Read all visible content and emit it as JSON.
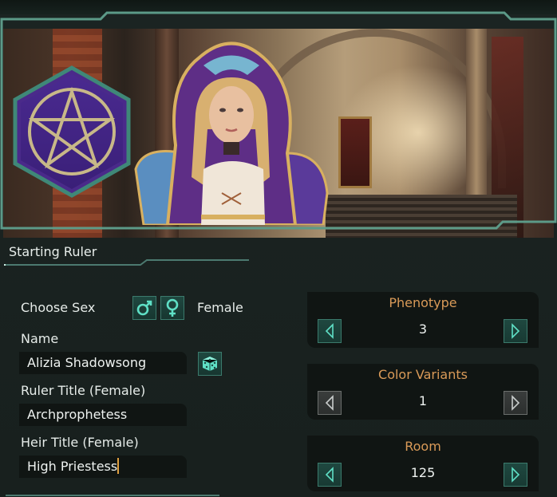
{
  "section": {
    "title": "Starting Ruler"
  },
  "sex": {
    "label": "Choose Sex",
    "male_icon": "male-symbol-icon",
    "female_icon": "female-symbol-icon",
    "selected": "Female"
  },
  "name": {
    "label": "Name",
    "value": "Alizia Shadowsong",
    "randomize_icon": "dice-icon"
  },
  "ruler_title": {
    "label": "Ruler Title (Female)",
    "value": "Archprophetess"
  },
  "heir_title": {
    "label": "Heir Title (Female)",
    "value": "High Priestess"
  },
  "emblem": {
    "icon": "pentagram-icon",
    "color": "#4a2a8a"
  },
  "steppers": [
    {
      "title": "Phenotype",
      "value": "3",
      "left_enabled": true,
      "right_enabled": true
    },
    {
      "title": "Color Variants",
      "value": "1",
      "left_enabled": false,
      "right_enabled": false
    },
    {
      "title": "Room",
      "value": "125",
      "left_enabled": true,
      "right_enabled": true
    }
  ],
  "colors": {
    "accent": "#3b7a6c",
    "title_orange": "#d99a58",
    "background": "#1a2220",
    "field": "#101513",
    "caret": "#e0a040"
  }
}
